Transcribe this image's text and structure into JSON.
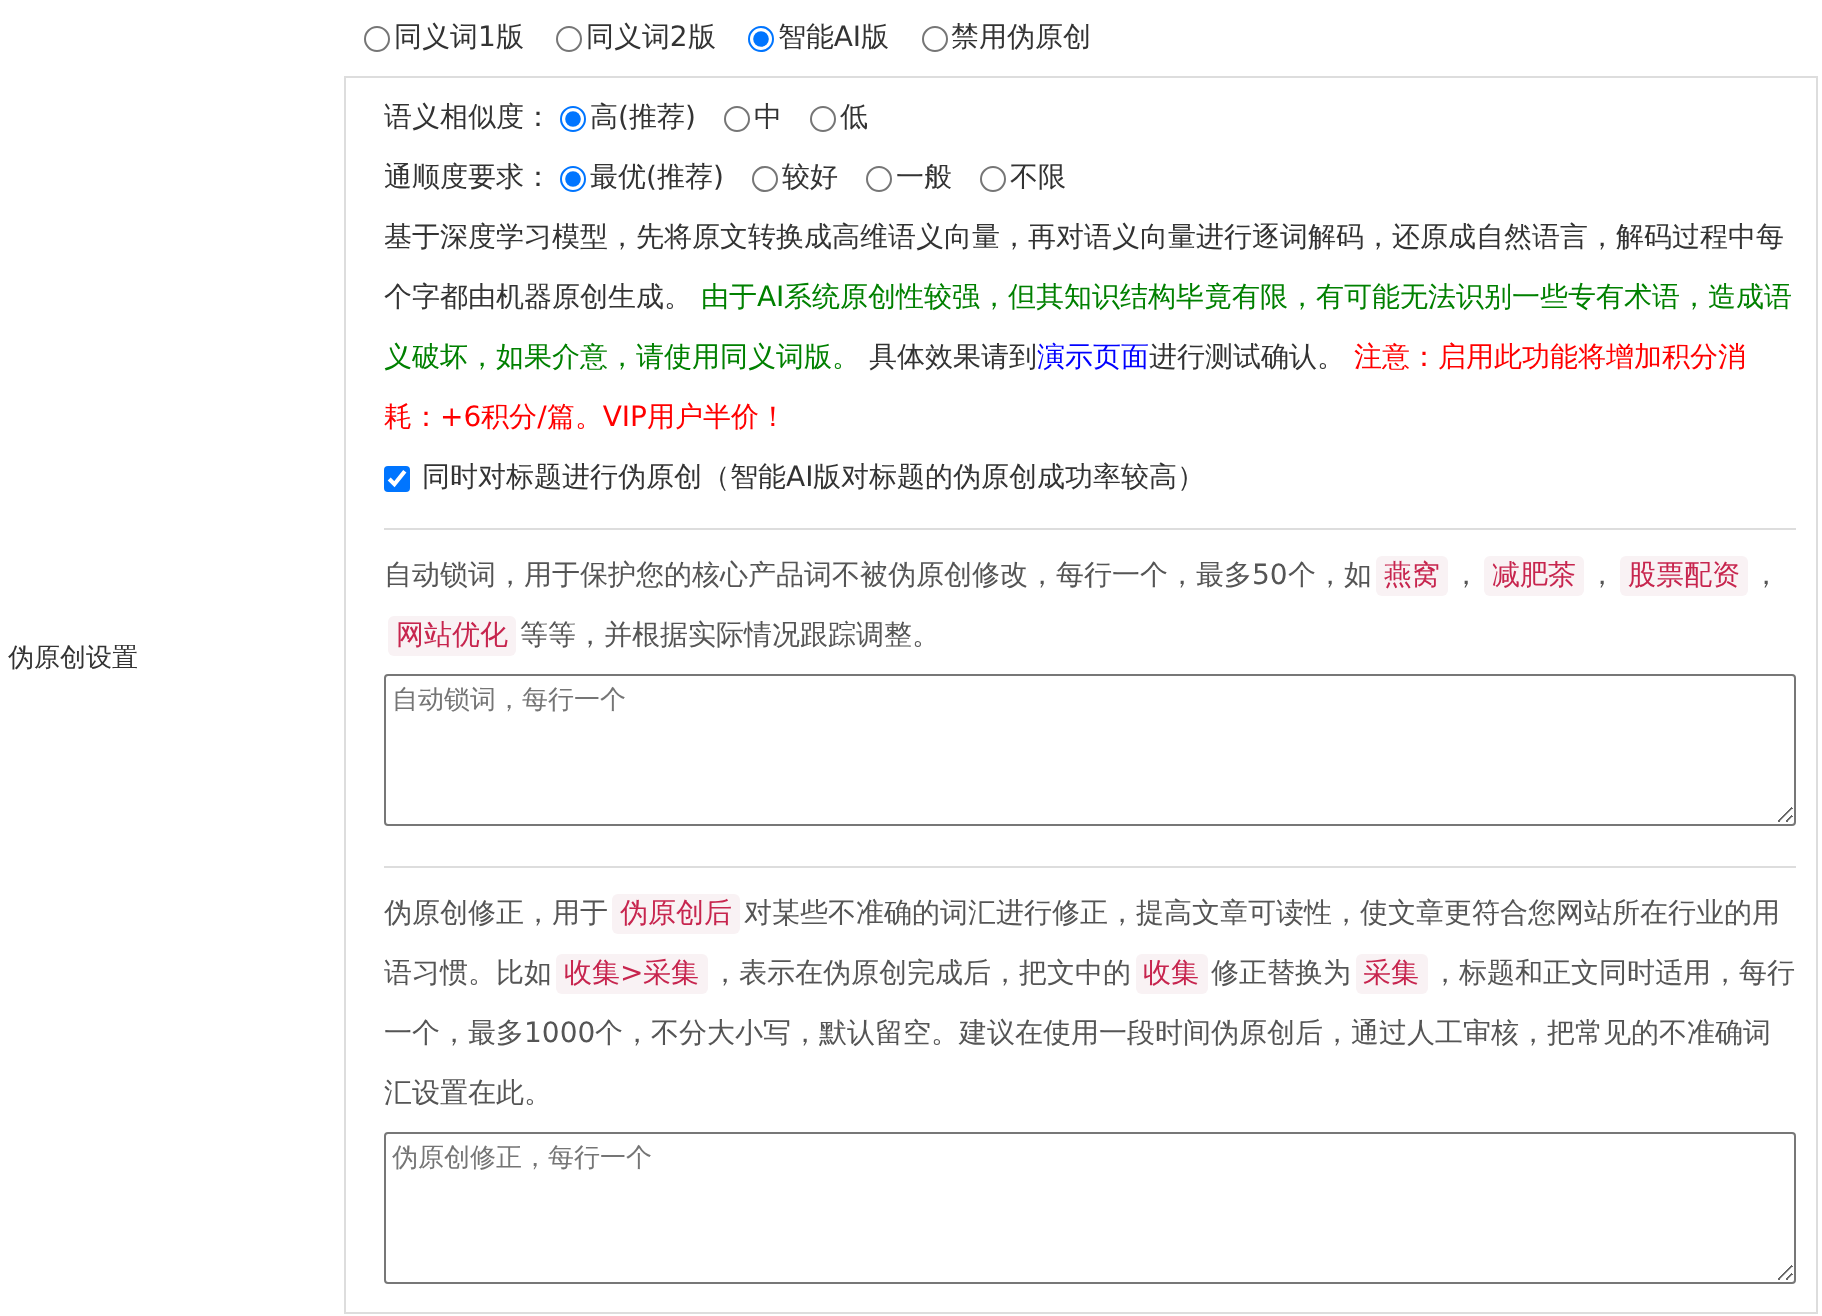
{
  "setting_label": "伪原创设置",
  "modes": [
    {
      "label": "同义词1版",
      "selected": false
    },
    {
      "label": "同义词2版",
      "selected": false
    },
    {
      "label": "智能AI版",
      "selected": true
    },
    {
      "label": "禁用伪原创",
      "selected": false
    }
  ],
  "similarity": {
    "label": "语义相似度：",
    "options": [
      {
        "label": "高(推荐)",
        "selected": true
      },
      {
        "label": "中",
        "selected": false
      },
      {
        "label": "低",
        "selected": false
      }
    ]
  },
  "fluency": {
    "label": "通顺度要求：",
    "options": [
      {
        "label": "最优(推荐)",
        "selected": true
      },
      {
        "label": "较好",
        "selected": false
      },
      {
        "label": "一般",
        "selected": false
      },
      {
        "label": "不限",
        "selected": false
      }
    ]
  },
  "ai_description": [
    {
      "kind": "text",
      "text": "基于深度学习模型，先将原文转换成高维语义向量，再对语义向量进行逐词解码，还原成自然语言，解码过程中每个字都由机器原创生成。 "
    },
    {
      "kind": "green",
      "text": "由于AI系统原创性较强，但其知识结构毕竟有限，有可能无法识别一些专有术语，造成语义破坏，如果介意，请使用同义词版。"
    },
    {
      "kind": "text",
      "text": " 具体效果请到"
    },
    {
      "kind": "link",
      "text": "演示页面"
    },
    {
      "kind": "text",
      "text": "进行测试确认。 "
    },
    {
      "kind": "red",
      "text": "注意：启用此功能将增加积分消耗：+6积分/篇。VIP用户半价！"
    }
  ],
  "title_option": {
    "label": "同时对标题进行伪原创（智能AI版对标题的伪原创成功率较高）",
    "checked": true
  },
  "lock_words": {
    "description": [
      {
        "kind": "text",
        "text": "自动锁词，用于保护您的核心产品词不被伪原创修改，每行一个，最多50个，如"
      },
      {
        "kind": "code",
        "text": "燕窝"
      },
      {
        "kind": "text",
        "text": "，"
      },
      {
        "kind": "code",
        "text": "减肥茶"
      },
      {
        "kind": "text",
        "text": "，"
      },
      {
        "kind": "code",
        "text": "股票配资"
      },
      {
        "kind": "text",
        "text": "，"
      },
      {
        "kind": "code",
        "text": "网站优化"
      },
      {
        "kind": "text",
        "text": "等等，并根据实际情况跟踪调整。"
      }
    ],
    "placeholder": "自动锁词，每行一个"
  },
  "correction": {
    "description": [
      {
        "kind": "text",
        "text": "伪原创修正，用于"
      },
      {
        "kind": "code",
        "text": "伪原创后"
      },
      {
        "kind": "text",
        "text": "对某些不准确的词汇进行修正，提高文章可读性，使文章更符合您网站所在行业的用语习惯。比如"
      },
      {
        "kind": "code",
        "text": "收集>采集"
      },
      {
        "kind": "text",
        "text": "，表示在伪原创完成后，把文中的"
      },
      {
        "kind": "code",
        "text": "收集"
      },
      {
        "kind": "text",
        "text": "修正替换为"
      },
      {
        "kind": "code",
        "text": "采集"
      },
      {
        "kind": "text",
        "text": "，标题和正文同时适用，每行一个，最多1000个，不分大小写，默认留空。建议在使用一段时间伪原创后，通过人工审核，把常见的不准确词汇设置在此。"
      }
    ],
    "placeholder": "伪原创修正，每行一个"
  }
}
